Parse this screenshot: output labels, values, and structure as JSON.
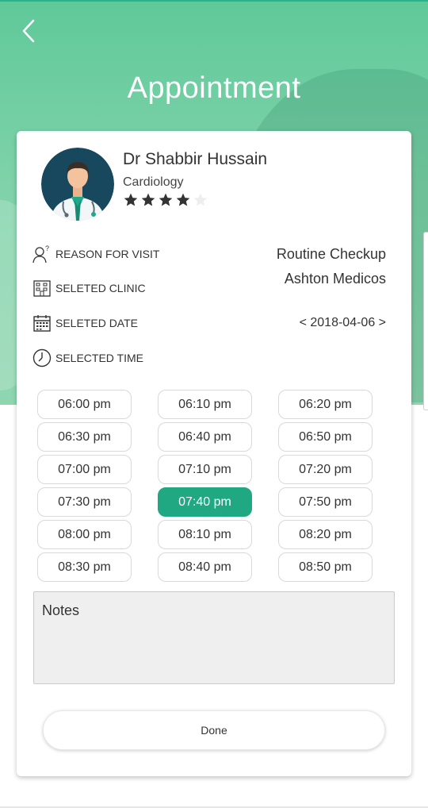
{
  "header": {
    "title": "Appointment"
  },
  "doctor": {
    "name": "Dr Shabbir Hussain",
    "specialty": "Cardiology",
    "rating": 4,
    "rating_max": 5
  },
  "details": {
    "reason": {
      "label": "REASON FOR VISIT",
      "value": "Routine Checkup"
    },
    "clinic": {
      "label": "SELETED CLINIC",
      "value": "Ashton Medicos"
    },
    "date": {
      "label": "SELETED DATE",
      "value": "< 2018-04-06 >"
    },
    "time": {
      "label": "SELECTED TIME"
    }
  },
  "time_slots": [
    "06:00 pm",
    "06:10 pm",
    "06:20 pm",
    "06:30 pm",
    "06:40 pm",
    "06:50 pm",
    "07:00 pm",
    "07:10 pm",
    "07:20 pm",
    "07:30 pm",
    "07:40 pm",
    "07:50 pm",
    "08:00 pm",
    "08:10 pm",
    "08:20 pm",
    "08:30 pm",
    "08:40 pm",
    "08:50 pm"
  ],
  "selected_slot": "07:40 pm",
  "notes": {
    "placeholder": "Notes"
  },
  "actions": {
    "done_label": "Done"
  },
  "colors": {
    "accent": "#20a882",
    "header_gradient_top": "#5fc99a",
    "header_gradient_bottom": "#8fd6b0"
  }
}
